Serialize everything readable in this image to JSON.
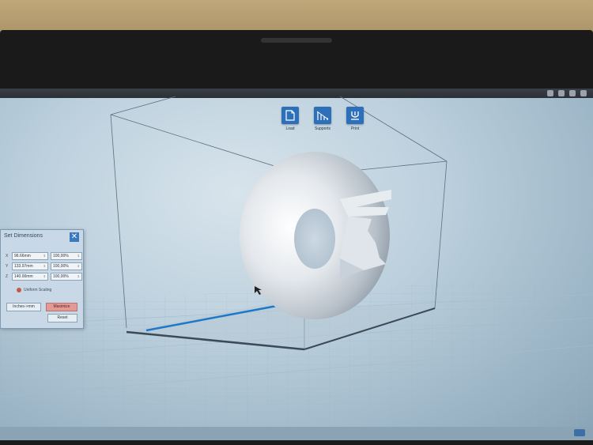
{
  "toolbar": {
    "load_label": "Load",
    "supports_label": "Supports",
    "print_label": "Print"
  },
  "dimensions_panel": {
    "title": "Set Dimensions",
    "close_glyph": "✕",
    "rows": [
      {
        "axis": "X",
        "size": "96.66mm",
        "percent": "100,00%"
      },
      {
        "axis": "Y",
        "size": "133.97mm",
        "percent": "100,00%"
      },
      {
        "axis": "Z",
        "size": "140.00mm",
        "percent": "100,00%"
      }
    ],
    "uniform_label": "Uniform Scaling",
    "left_button": "Inches->mm",
    "right_button": "Maximize",
    "reset_button": "Reset"
  },
  "icons": {
    "load": "load-file-icon",
    "supports": "supports-icon",
    "print": "print-icon",
    "close": "close-icon",
    "lock": "lock-icon"
  },
  "colors": {
    "accent": "#2d6fb8",
    "build_plate_edge": "#1e78c8",
    "maximize_button": "#e39a95"
  }
}
